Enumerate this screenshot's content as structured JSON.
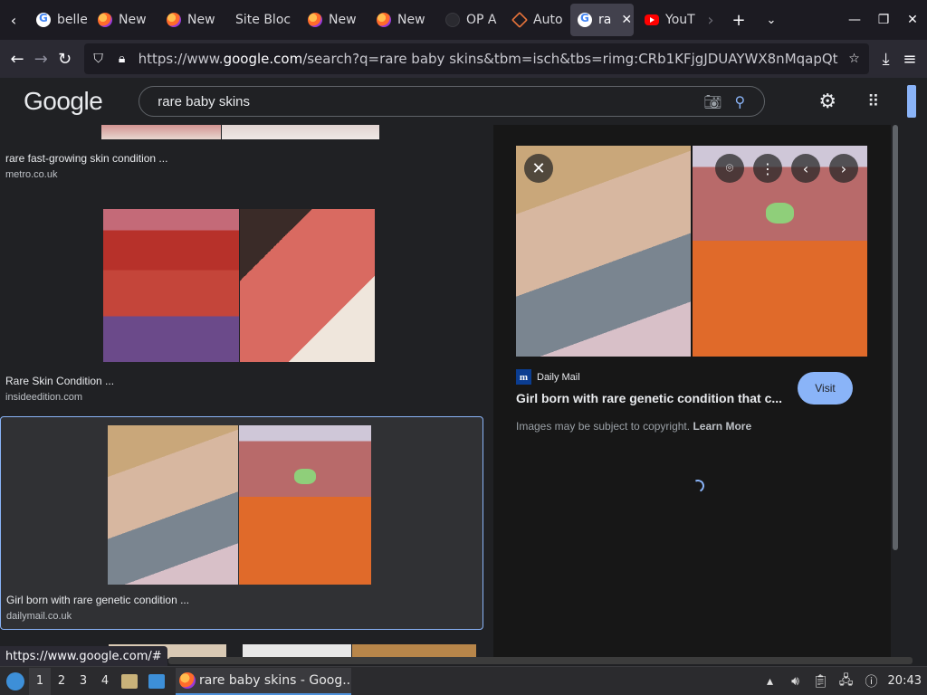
{
  "browser": {
    "tabs": [
      {
        "label": "belle",
        "favicon": "google-icon",
        "active": false
      },
      {
        "label": "New",
        "favicon": "firefox-icon",
        "active": false
      },
      {
        "label": "New",
        "favicon": "firefox-icon",
        "active": false
      },
      {
        "label": "Site Bloc",
        "favicon": "none",
        "active": false
      },
      {
        "label": "New",
        "favicon": "firefox-icon",
        "active": false
      },
      {
        "label": "New",
        "favicon": "firefox-icon",
        "active": false
      },
      {
        "label": "OP A",
        "favicon": "dark-icon",
        "active": false
      },
      {
        "label": "Auto",
        "favicon": "diamond-icon",
        "active": false
      },
      {
        "label": "ra",
        "favicon": "google-icon",
        "active": true
      },
      {
        "label": "YouT",
        "favicon": "youtube-icon",
        "active": false
      }
    ],
    "url_prefix": "https://www.",
    "url_host": "google.com",
    "url_rest": "/search?q=rare baby skins&tbm=isch&tbs=rimg:CRb1KFjgJDUAYWX8nMqapQt"
  },
  "google": {
    "logo": "Google",
    "search_value": "rare baby skins"
  },
  "results": [
    {
      "title": "rare fast-growing skin condition ...",
      "site": "metro.co.uk"
    },
    {
      "title": "Rare Skin Condition ...",
      "site": "insideedition.com"
    },
    {
      "title": "Girl born with rare genetic condition ...",
      "site": "dailymail.co.uk"
    }
  ],
  "preview": {
    "source_logo": "m",
    "source_name": "Daily Mail",
    "title": "Girl born with rare genetic condition that c...",
    "visit_label": "Visit",
    "copyright_text": "Images may be subject to copyright.",
    "learn_more": "Learn More"
  },
  "status_url": "https://www.google.com/#",
  "taskbar": {
    "workspaces": [
      "1",
      "2",
      "3",
      "4"
    ],
    "active_task": "rare baby skins - Goog...",
    "clock": "20:43"
  },
  "colors": {
    "accent": "#8ab4f8",
    "background": "#202124",
    "preview_bg": "#171717"
  }
}
